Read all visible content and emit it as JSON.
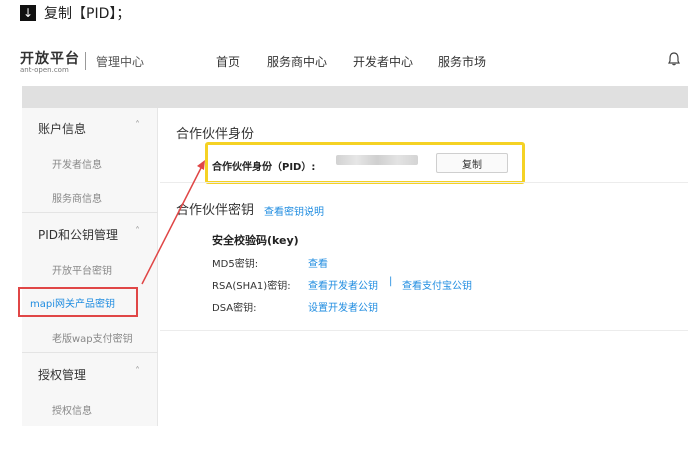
{
  "step": {
    "icon": "download-arrow-icon",
    "text": "复制【PID】；"
  },
  "topnav": {
    "logo_name": "开放平台",
    "logo_url": "ant-open.com",
    "subtitle": "管理中心",
    "items": [
      "首页",
      "服务商中心",
      "开发者中心",
      "服务市场"
    ],
    "bell_icon": "bell-icon"
  },
  "sidebar": {
    "groups": [
      {
        "label": "账户信息",
        "items": [
          "开发者信息",
          "服务商信息"
        ]
      },
      {
        "label": "PID和公钥管理",
        "items": [
          "开放平台密钥",
          "mapi网关产品密钥",
          "老版wap支付密钥"
        ]
      },
      {
        "label": "授权管理",
        "items": [
          "授权信息"
        ]
      }
    ],
    "active_item": "mapi网关产品密钥"
  },
  "main": {
    "partner_id_title": "合作伙伴身份",
    "pid_label": "合作伙伴身份（PID）:",
    "copy_button": "复制",
    "partner_key_title": "合作伙伴密钥",
    "view_key_help": "查看密钥说明",
    "security_key_title": "安全校验码(key)",
    "md5_label": "MD5密钥:",
    "md5_link": "查看",
    "rsa_label": "RSA(SHA1)密钥:",
    "rsa_link1": "查看开发者公钥",
    "rsa_sep": "|",
    "rsa_link2": "查看支付宝公钥",
    "dsa_label": "DSA密钥:",
    "dsa_link": "设置开发者公钥"
  },
  "colors": {
    "link": "#1f8ce0",
    "highlight": "#f5d224",
    "annotation": "#e04646"
  }
}
